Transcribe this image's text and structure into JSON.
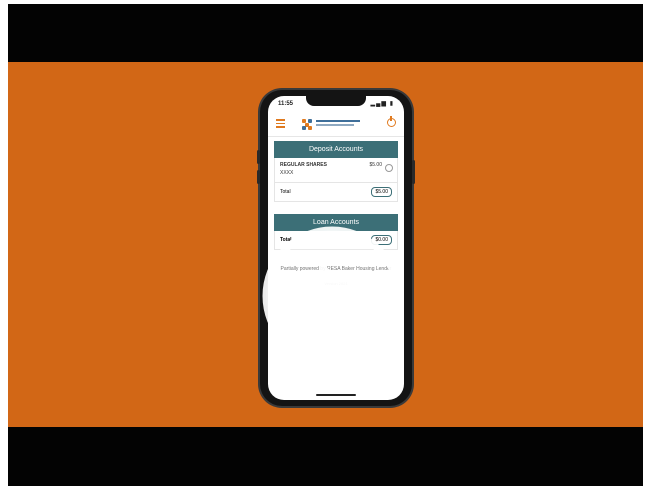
{
  "status_bar": {
    "time": "11:55",
    "signal": "▂▄▆ ▮"
  },
  "app": {
    "section_deposit": "Deposit Accounts",
    "account": {
      "name": "REGULAR SHARES",
      "number": "XXXX",
      "amount": "$5.00"
    },
    "total_left": {
      "label": "Total",
      "amount": "$5.00"
    },
    "section_loan": "Loan Accounts",
    "total_right": {
      "label": "Total",
      "amount": "$0.00"
    },
    "footer": "Partially powered by RESA Baker Housing Lender",
    "footer_small": "Version 2021"
  },
  "video": {
    "control": "play-button"
  },
  "colors": {
    "band": "#d26716",
    "teal": "#3c6f77",
    "accent": "#e07a1f"
  }
}
